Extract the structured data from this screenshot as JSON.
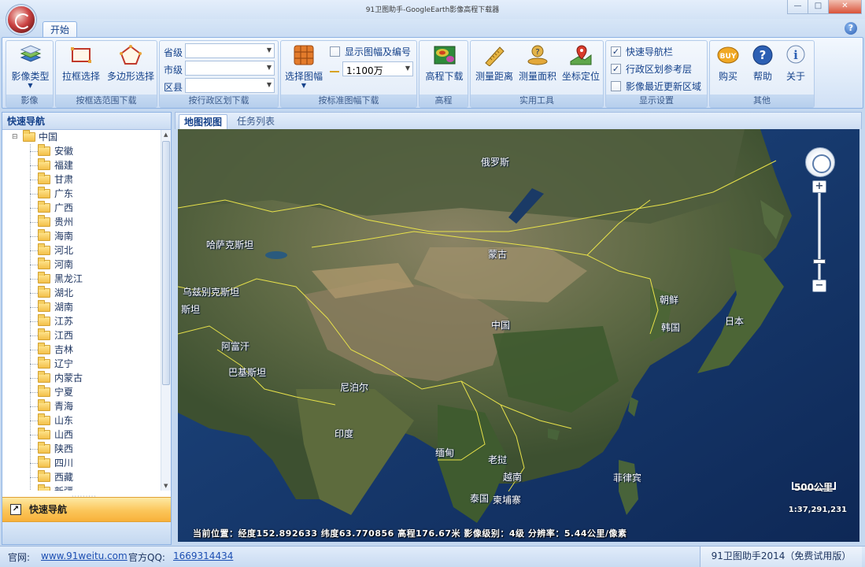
{
  "window": {
    "title": "91卫图助手-GoogleEarth影像高程下载器",
    "controls": [
      "—",
      "□",
      "✕"
    ]
  },
  "ribbon": {
    "tab": "开始",
    "help": "?",
    "groups": {
      "imagery": {
        "caption": "影像",
        "button": "影像类型"
      },
      "rect_select": {
        "caption": "按框选范围下载",
        "rect": "拉框选择",
        "polygon": "多边形选择"
      },
      "admin": {
        "caption": "按行政区划下载",
        "province_label": "省级",
        "city_label": "市级",
        "county_label": "区县",
        "province_value": "",
        "city_value": "",
        "county_value": ""
      },
      "sheet": {
        "caption": "按标准图幅下载",
        "select_button": "选择图幅",
        "show_sheet_label": "显示图幅及编号",
        "scale_value": "1:100万"
      },
      "elevation": {
        "caption": "高程",
        "button": "高程下载"
      },
      "tools": {
        "caption": "实用工具",
        "distance": "测量距离",
        "area": "测量面积",
        "locate": "坐标定位"
      },
      "display": {
        "caption": "显示设置",
        "quick_nav": "快速导航栏",
        "admin_layer": "行政区划参考层",
        "recent_update": "影像最近更新区域",
        "quick_nav_checked": true,
        "admin_layer_checked": true,
        "recent_update_checked": false
      },
      "other": {
        "caption": "其他",
        "buy": "购买",
        "help": "帮助",
        "about": "关于",
        "buy_badge": "BUY"
      }
    }
  },
  "sidebar": {
    "title": "快速导航",
    "root": "中国",
    "provinces": [
      "安徽",
      "福建",
      "甘肃",
      "广东",
      "广西",
      "贵州",
      "海南",
      "河北",
      "河南",
      "黑龙江",
      "湖北",
      "湖南",
      "江苏",
      "江西",
      "吉林",
      "辽宁",
      "内蒙古",
      "宁夏",
      "青海",
      "山东",
      "山西",
      "陕西",
      "四川",
      "西藏",
      "新疆"
    ],
    "quick_nav_button": "快速导航"
  },
  "map": {
    "tabs": [
      "地图视图",
      "任务列表"
    ],
    "labels": [
      {
        "text": "俄罗斯"
      },
      {
        "text": "哈萨克斯坦"
      },
      {
        "text": "蒙古"
      },
      {
        "text": "乌兹别克斯坦"
      },
      {
        "text": "斯坦"
      },
      {
        "text": "中国"
      },
      {
        "text": "朝鲜"
      },
      {
        "text": "韩国"
      },
      {
        "text": "日本"
      },
      {
        "text": "阿富汗"
      },
      {
        "text": "巴基斯坦"
      },
      {
        "text": "尼泊尔"
      },
      {
        "text": "印度"
      },
      {
        "text": "缅甸"
      },
      {
        "text": "老挝"
      },
      {
        "text": "越南"
      },
      {
        "text": "泰国"
      },
      {
        "text": "柬埔寨"
      },
      {
        "text": "菲律宾"
      }
    ],
    "scale_label": "500公里",
    "scale_ratio": "1:37,291,231",
    "status_text": "当前位置：经度152.892633 纬度63.770856 高程176.67米  影像级别：4级 分辨率：5.44公里/像素"
  },
  "statusbar": {
    "site_label": "官网:",
    "site_url": "www.91weitu.com",
    "qq_label": "官方QQ:",
    "qq_number": "1669314434",
    "version": "91卫图助手2014（免费试用版）"
  }
}
